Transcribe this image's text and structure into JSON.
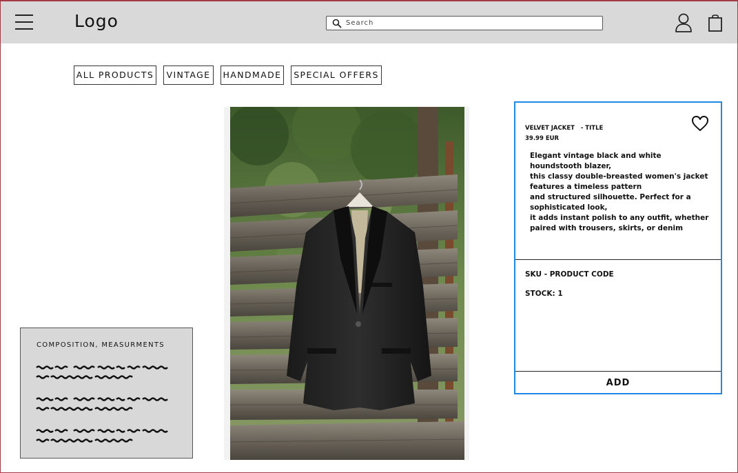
{
  "header": {
    "logo": "Logo",
    "search_placeholder": "Search"
  },
  "categories": [
    "ALL PRODUCTS",
    "VINTAGE",
    "HANDMADE",
    "SPECIAL OFFERS"
  ],
  "composition": {
    "title": "COMPOSITION, MEASURMENTS"
  },
  "product": {
    "title": "VELVET JACKET   - TITLE",
    "price": "39.99 EUR",
    "description_lines": [
      "Elegant vintage black and white houndstooth blazer,",
      "this classy double-breasted women's jacket features a timeless pattern",
      "and structured silhouette. Perfect for a sophisticated look,",
      "it adds instant polish to any outfit, whether paired with trousers, skirts, or denim"
    ],
    "sku": "SKU - PRODUCT CODE",
    "stock": "STOCK: 1",
    "add_label": "ADD"
  },
  "icons": {
    "menu": "hamburger-menu-icon",
    "search": "search-icon",
    "user": "user-icon",
    "bag": "shopping-bag-icon",
    "favorite": "heart-icon"
  },
  "colors": {
    "header_bg": "#d9d9d9",
    "card_border": "#1e88e5",
    "composition_bg": "#d8d8d8"
  }
}
